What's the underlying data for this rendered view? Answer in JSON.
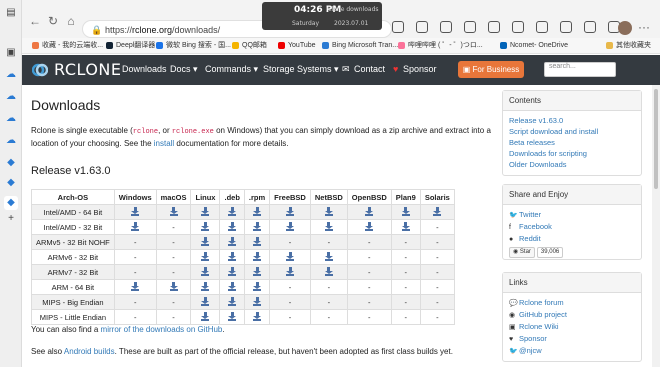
{
  "browser": {
    "url_prefix": "https://",
    "url_host": "rclone.org",
    "url_path": "/downloads/",
    "bookmarks": [
      "收藏 - 我的云端收...",
      "Deepl翻译器",
      "微软 Bing 搜索 - 国...",
      "QQ邮箱",
      "YouTube",
      "Bing Microsoft Tran...",
      "哔哩哔哩 ( ゜- ゜)つロ...",
      "Ncomet- OneDrive",
      "其他收藏夹"
    ]
  },
  "clock": {
    "time": "04:26 PM",
    "day": "Saturday",
    "date": "2023.07.01",
    "note": "rclone downloads"
  },
  "site": {
    "logo": "RCLONE",
    "nav": [
      "Downloads",
      "Docs ▾",
      "Commands ▾",
      "Storage Systems ▾",
      "Contact",
      "Sponsor"
    ],
    "business_button": "For Business",
    "search_placeholder": "search..."
  },
  "page": {
    "title": "Downloads",
    "intro_1": "Rclone is single executable (",
    "code_1": "rclone",
    "intro_2": ", or ",
    "code_2": "rclone.exe",
    "intro_3": " on Windows) that you can simply download as a zip archive and extract into a location of your choosing. See the ",
    "install_link": "install",
    "intro_4": " documentation for more details.",
    "release_heading": "Release v1.63.0",
    "after_table_1": "You can also find a ",
    "mirror_link": "mirror of the downloads on GitHub",
    "after_table_1b": ".",
    "after_table_2": "See also ",
    "android_link": "Android builds",
    "after_table_2b": ". These are built as part of the official release, but haven't been adopted as first class builds yet."
  },
  "table": {
    "headers": [
      "Arch-OS",
      "Windows",
      "macOS",
      "Linux",
      ".deb",
      ".rpm",
      "FreeBSD",
      "NetBSD",
      "OpenBSD",
      "Plan9",
      "Solaris"
    ],
    "rows": [
      {
        "arch": "Intel/AMD - 64 Bit",
        "cells": [
          "dl",
          "dl",
          "dl",
          "dl",
          "dl",
          "dl",
          "dl",
          "dl",
          "dl",
          "dl"
        ]
      },
      {
        "arch": "Intel/AMD - 32 Bit",
        "cells": [
          "dl",
          "-",
          "dl",
          "dl",
          "dl",
          "dl",
          "dl",
          "dl",
          "dl",
          "-"
        ]
      },
      {
        "arch": "ARMv5 - 32 Bit NOHF",
        "cells": [
          "-",
          "-",
          "dl",
          "dl",
          "dl",
          "-",
          "-",
          "-",
          "-",
          "-"
        ]
      },
      {
        "arch": "ARMv6 - 32 Bit",
        "cells": [
          "-",
          "-",
          "dl",
          "dl",
          "dl",
          "dl",
          "dl",
          "-",
          "-",
          "-"
        ]
      },
      {
        "arch": "ARMv7 - 32 Bit",
        "cells": [
          "-",
          "-",
          "dl",
          "dl",
          "dl",
          "dl",
          "dl",
          "-",
          "-",
          "-"
        ]
      },
      {
        "arch": "ARM - 64 Bit",
        "cells": [
          "dl",
          "dl",
          "dl",
          "dl",
          "dl",
          "-",
          "-",
          "-",
          "-",
          "-"
        ]
      },
      {
        "arch": "MIPS - Big Endian",
        "cells": [
          "-",
          "-",
          "dl",
          "dl",
          "dl",
          "-",
          "-",
          "-",
          "-",
          "-"
        ]
      },
      {
        "arch": "MIPS - Little Endian",
        "cells": [
          "-",
          "-",
          "dl",
          "dl",
          "dl",
          "-",
          "-",
          "-",
          "-",
          "-"
        ]
      }
    ]
  },
  "sidebar": {
    "contents_title": "Contents",
    "contents": [
      "Release v1.63.0",
      "Script download and install",
      "Beta releases",
      "Downloads for scripting",
      "Older Downloads"
    ],
    "share_title": "Share and Enjoy",
    "share": [
      {
        "icon": "twitter-icon",
        "glyph": "🐦",
        "label": "Twitter"
      },
      {
        "icon": "facebook-icon",
        "glyph": "f",
        "label": "Facebook"
      },
      {
        "icon": "reddit-icon",
        "glyph": "●",
        "label": "Reddit"
      }
    ],
    "star_label": "Star",
    "star_count": "39,006",
    "links_title": "Links",
    "links": [
      {
        "icon": "forum-icon",
        "glyph": "💬",
        "label": "Rclone forum"
      },
      {
        "icon": "github-icon",
        "glyph": "◉",
        "label": "GitHub project"
      },
      {
        "icon": "book-icon",
        "glyph": "▣",
        "label": "Rclone Wiki"
      },
      {
        "icon": "heart-icon",
        "glyph": "♥",
        "label": "Sponsor"
      },
      {
        "icon": "twitter-icon",
        "glyph": "🐦",
        "label": "@njcw"
      }
    ]
  }
}
